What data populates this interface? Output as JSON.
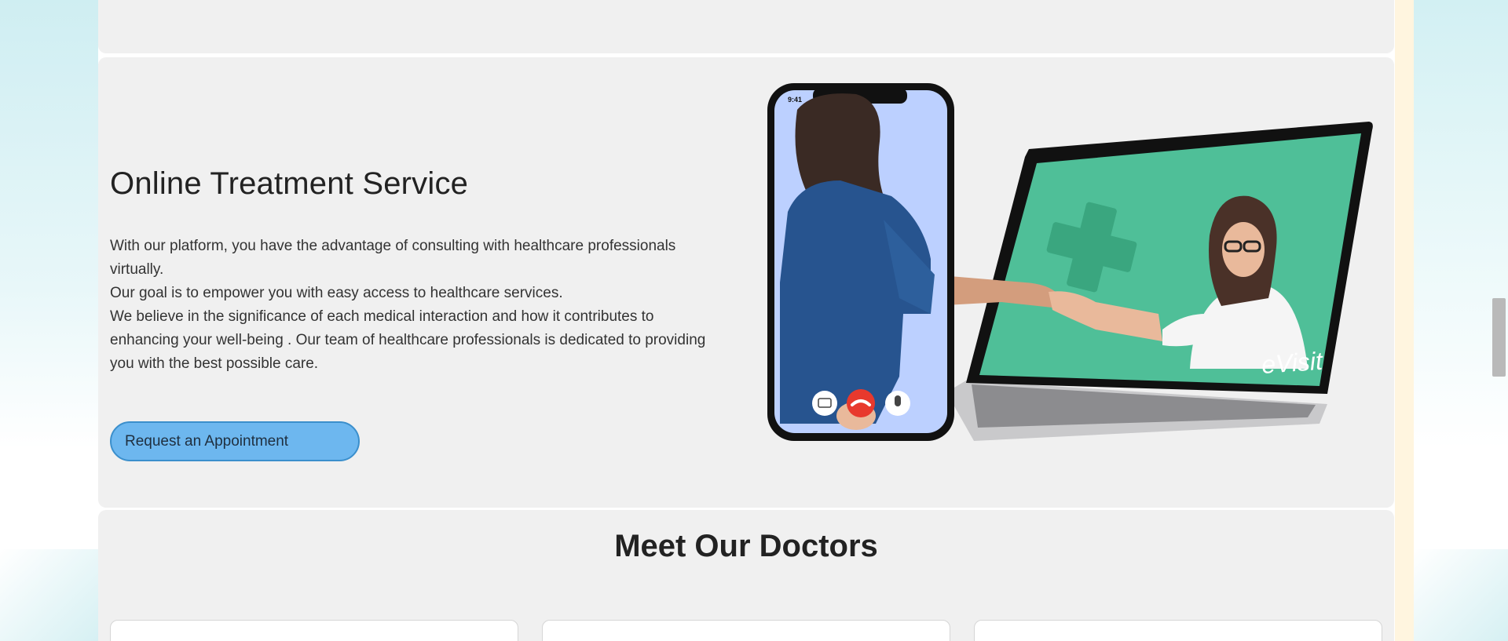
{
  "hero": {
    "title": "Online Treatment Service",
    "paragraphs": [
      "With our platform, you have the advantage of consulting with healthcare professionals virtually.",
      "Our goal is to empower you with easy access to healthcare services.",
      "We believe in the significance of each medical interaction and how it contributes to enhancing your well-being . Our team of healthcare professionals is dedicated to providing you with the best possible care."
    ],
    "button_label": "Request an Appointment"
  },
  "illustration": {
    "phone_time": "9:41",
    "laptop_brand": "eVisit"
  },
  "doctors": {
    "title": "Meet Our Doctors"
  },
  "colors": {
    "button": "#6db7ef",
    "panel": "#f0f0f0",
    "laptop_screen": "#4fbf98",
    "hangup": "#e8392d"
  }
}
